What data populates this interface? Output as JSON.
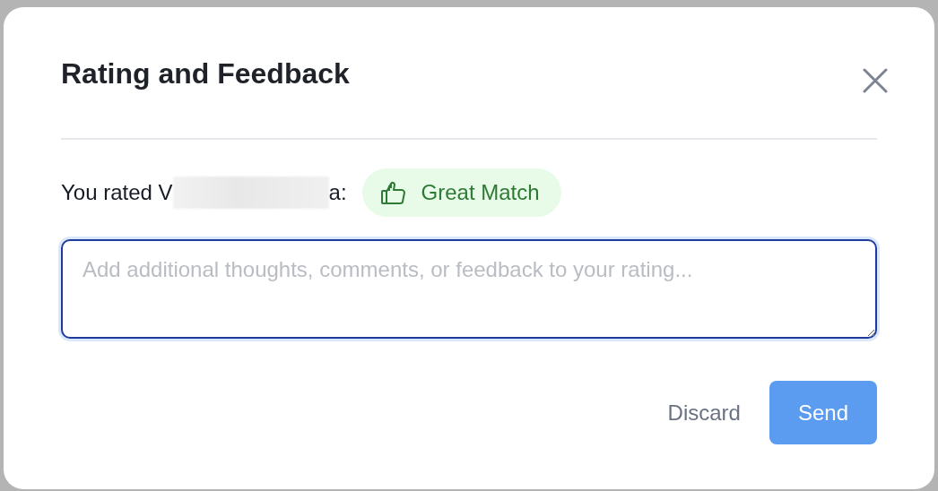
{
  "dialog": {
    "title": "Rating and Feedback",
    "rating": {
      "prefix": "You rated V",
      "suffix": "a:",
      "badge": "Great Match"
    },
    "feedback": {
      "placeholder": "Add additional thoughts, comments, or feedback to your rating..."
    },
    "buttons": [
      {
        "kind": "text",
        "label": "Discard"
      },
      {
        "kind": "primary",
        "label": "Send"
      }
    ]
  }
}
